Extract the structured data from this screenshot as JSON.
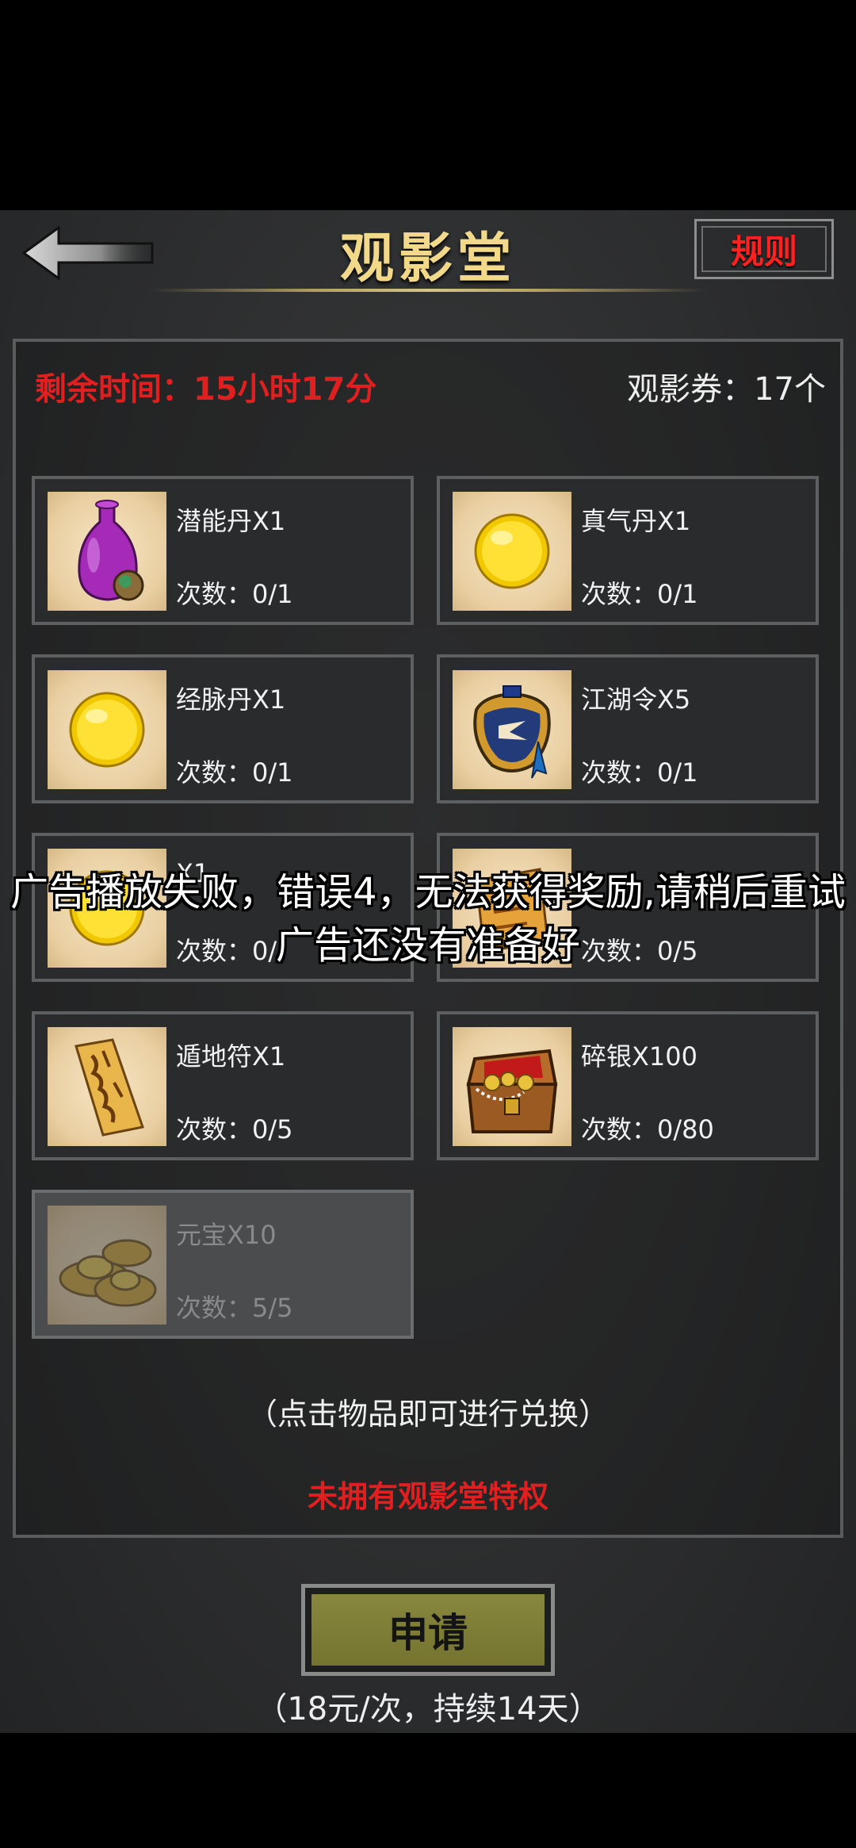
{
  "header": {
    "title": "观影堂",
    "rules_label": "规则"
  },
  "status": {
    "remaining_time": "剩余时间：15小时17分",
    "tickets": "观影券：17个"
  },
  "items": [
    {
      "name": "潜能丹X1",
      "count": "次数：0/1",
      "icon": "purple-vase-icon",
      "disabled": false
    },
    {
      "name": "真气丹X1",
      "count": "次数：0/1",
      "icon": "gold-pill-icon",
      "disabled": false
    },
    {
      "name": "经脉丹X1",
      "count": "次数：0/1",
      "icon": "gold-pill-icon",
      "disabled": false
    },
    {
      "name": "江湖令X5",
      "count": "次数：0/1",
      "icon": "jianghu-token-bag-icon",
      "disabled": false
    },
    {
      "name": "X1",
      "count": "次数：0/",
      "icon": "gold-pill-icon",
      "disabled": false
    },
    {
      "name": "",
      "count": "次数：0/5",
      "icon": "scroll-icon",
      "disabled": false
    },
    {
      "name": "遁地符X1",
      "count": "次数：0/5",
      "icon": "talisman-icon",
      "disabled": false
    },
    {
      "name": "碎银X100",
      "count": "次数：0/80",
      "icon": "treasure-chest-icon",
      "disabled": false
    },
    {
      "name": "元宝X10",
      "count": "次数：5/5",
      "icon": "gold-ingot-icon",
      "disabled": true
    }
  ],
  "hint": "（点击物品即可进行兑换）",
  "privilege": "未拥有观影堂特权",
  "apply": {
    "label": "申请",
    "price": "（18元/次，持续14天）"
  },
  "toast": {
    "line1": "广告播放失败，错误4，无法获得奖励,请稍后重试",
    "line2": "广告还没有准备好"
  }
}
